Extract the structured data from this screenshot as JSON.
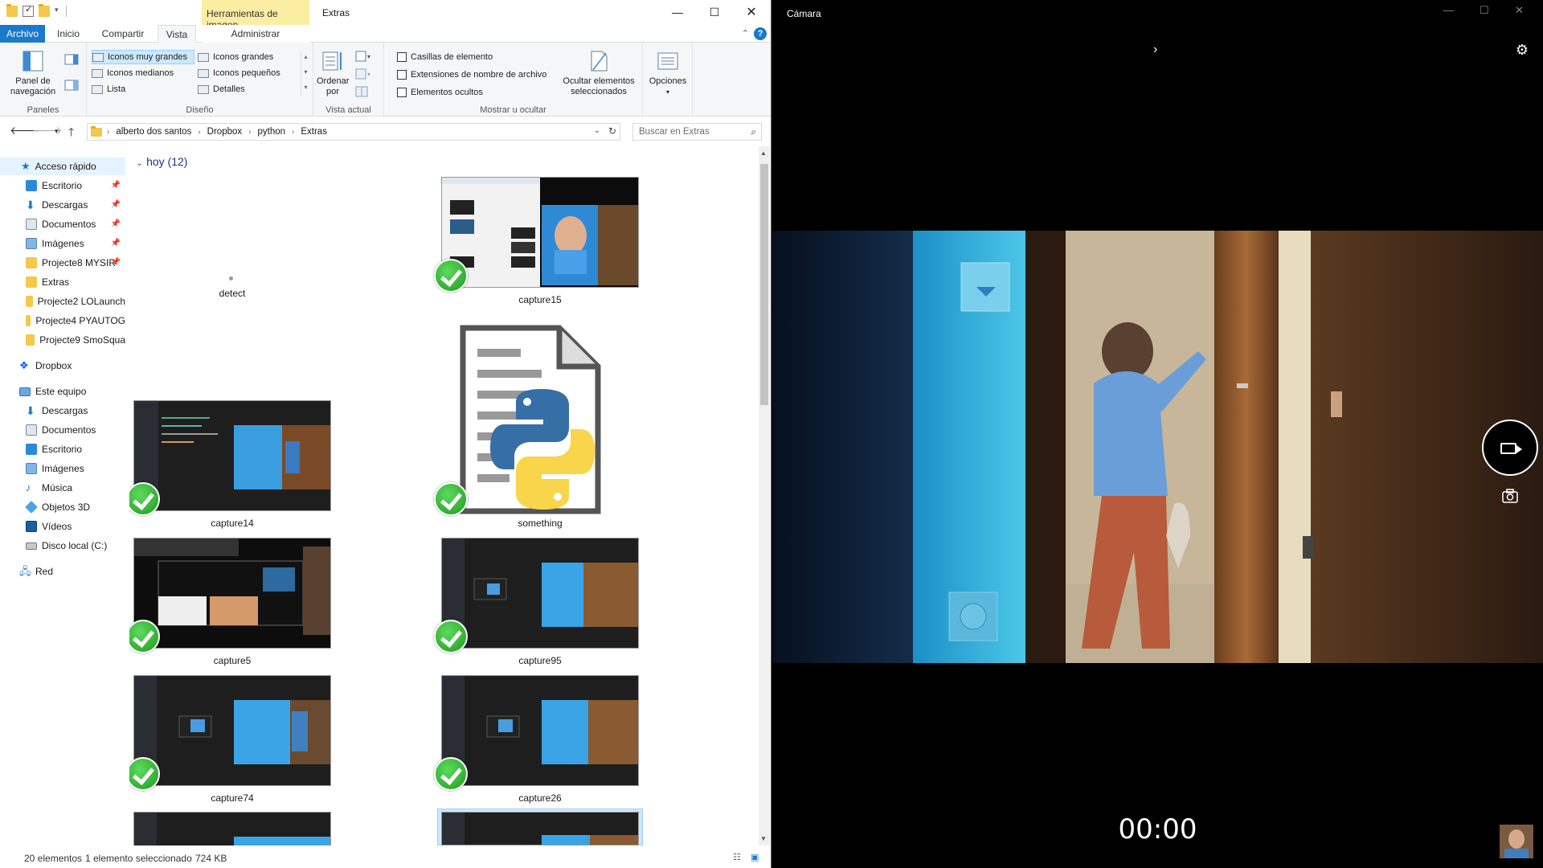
{
  "explorer": {
    "title": "Extras",
    "contextual_tab": "Herramientas de imagen",
    "ribbon_tabs": [
      "Archivo",
      "Inicio",
      "Compartir",
      "Vista",
      "Administrar"
    ],
    "ribbon": {
      "panes_group": "Paneles",
      "nav_pane_btn": "Panel de navegación",
      "layout_group": "Diseño",
      "layout_options": [
        "Iconos muy grandes",
        "Iconos grandes",
        "Iconos medianos",
        "Iconos pequeños",
        "Lista",
        "Detalles"
      ],
      "current_view_group": "Vista actual",
      "sort_btn": "Ordenar por",
      "show_hide_group": "Mostrar u ocultar",
      "checkboxes": [
        "Casillas de elemento",
        "Extensiones de nombre de archivo",
        "Elementos ocultos"
      ],
      "hide_selected_btn": "Ocultar elementos seleccionados",
      "options_btn": "Opciones"
    },
    "address": {
      "crumbs": [
        "alberto dos santos",
        "Dropbox",
        "python",
        "Extras"
      ],
      "search_placeholder": "Buscar en Extras"
    },
    "nav": {
      "quick_access": "Acceso rápido",
      "quick_items": [
        "Escritorio",
        "Descargas",
        "Documentos",
        "Imágenes",
        "Projecte8 MYSIR",
        "Extras",
        "Projecte2 LOLaunch",
        "Projecte4 PYAUTOG",
        "Projecte9 SmoSqua"
      ],
      "dropbox": "Dropbox",
      "this_pc": "Este equipo",
      "pc_items": [
        "Descargas",
        "Documentos",
        "Escritorio",
        "Imágenes",
        "Música",
        "Objetos 3D",
        "Vídeos",
        "Disco local (C:)"
      ],
      "network": "Red"
    },
    "group_header": "hoy (12)",
    "files": [
      {
        "name": "detect"
      },
      {
        "name": "capture15"
      },
      {
        "name": "capture14"
      },
      {
        "name": "something"
      },
      {
        "name": "capture5"
      },
      {
        "name": "capture95"
      },
      {
        "name": "capture74"
      },
      {
        "name": "capture26"
      }
    ],
    "status": {
      "count": "20 elementos",
      "selection": "1 elemento seleccionado",
      "size": "724 KB"
    }
  },
  "camera": {
    "title": "Cámara",
    "timer": "00:00"
  },
  "colors": {
    "accent": "#1979ca",
    "contextual_tab": "#fbeea3",
    "selection": "#cce8ff",
    "check_green": "#2ca82c"
  }
}
